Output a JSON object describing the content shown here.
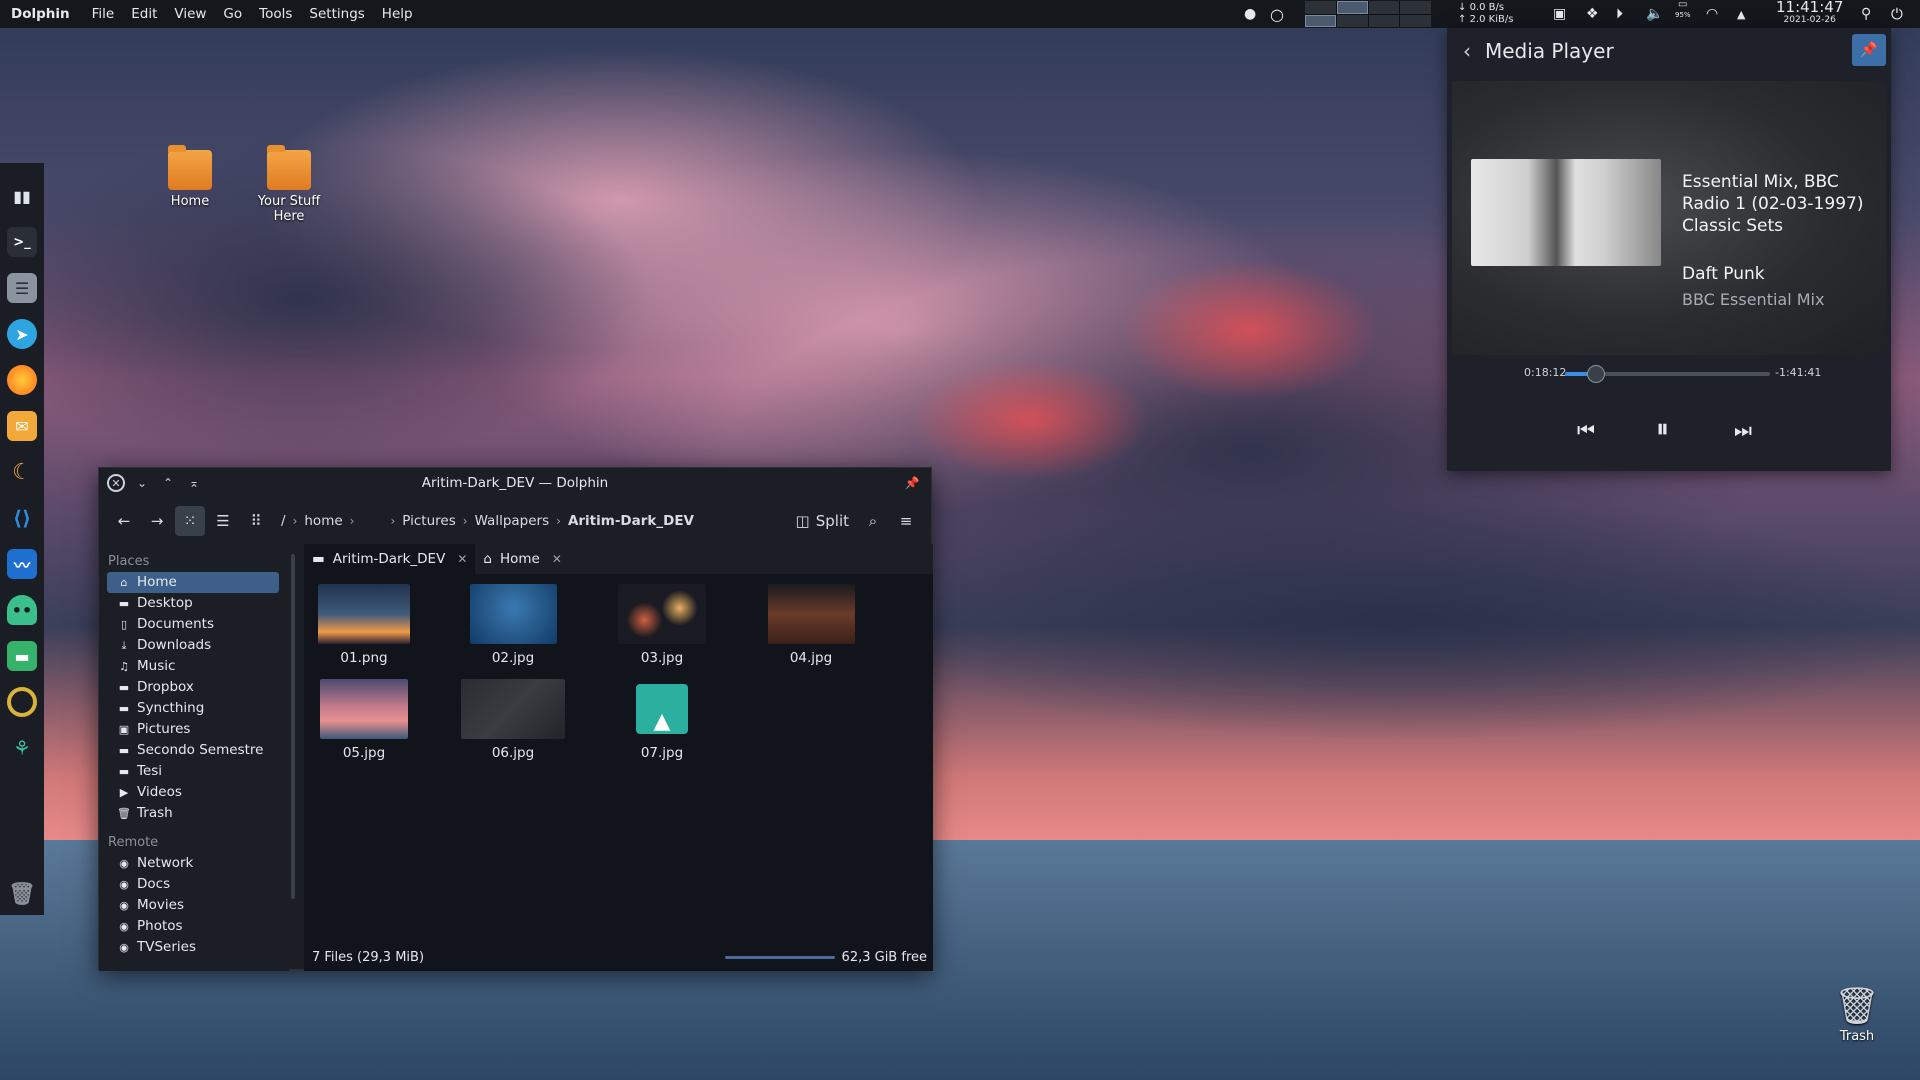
{
  "topbar": {
    "app_name": "Dolphin",
    "menus": [
      "File",
      "Edit",
      "View",
      "Go",
      "Tools",
      "Settings",
      "Help"
    ],
    "net_down": "0.0 B/s",
    "net_up": "2.0 KiB/s",
    "battery": "95%",
    "time": "11:41:47",
    "date": "2021-02-26"
  },
  "desktop": {
    "icons": [
      {
        "label": "Home"
      },
      {
        "label": "Your Stuff Here"
      }
    ],
    "trash_label": "Trash"
  },
  "dock": {
    "items": [
      "system-monitor-icon",
      "terminal-icon",
      "files-icon",
      "telegram-icon",
      "firefox-icon",
      "mail-icon",
      "night-light-icon",
      "vscode-icon",
      "activity-icon",
      "android-icon",
      "folder-icon",
      "record-icon",
      "plant-icon",
      "trash-icon"
    ]
  },
  "dolphin": {
    "title": "Aritim-Dark_DEV — Dolphin",
    "breadcrumb": {
      "root": "/",
      "home": "home",
      "pictures": "Pictures",
      "wallpapers": "Wallpapers",
      "current": "Aritim-Dark_DEV"
    },
    "split_label": "Split",
    "places_header": "Places",
    "places": [
      "Home",
      "Desktop",
      "Documents",
      "Downloads",
      "Music",
      "Dropbox",
      "Syncthing",
      "Pictures",
      "Secondo Semestre",
      "Tesi",
      "Videos",
      "Trash"
    ],
    "remote_header": "Remote",
    "remote": [
      "Network",
      "Docs",
      "Movies",
      "Photos",
      "TVSeries"
    ],
    "tabs": [
      {
        "label": "Aritim-Dark_DEV"
      },
      {
        "label": "Home"
      }
    ],
    "files": [
      "01.png",
      "02.jpg",
      "03.jpg",
      "04.jpg",
      "05.jpg",
      "06.jpg",
      "07.jpg"
    ],
    "status_left": "7 Files (29,3 MiB)",
    "status_right": "62,3 GiB free"
  },
  "media": {
    "title": "Media Player",
    "track_title": "Essential Mix, BBC Radio 1 (02-03-1997) Classic Sets",
    "artist": "Daft Punk",
    "album": "BBC Essential Mix",
    "elapsed": "0:18:12",
    "remaining": "-1:41:41",
    "progress": 0.15
  },
  "colors": {
    "accent": "#3d8ee0",
    "selection": "#3e5f8a",
    "panel": "#14171c",
    "window": "#1b1e24"
  }
}
